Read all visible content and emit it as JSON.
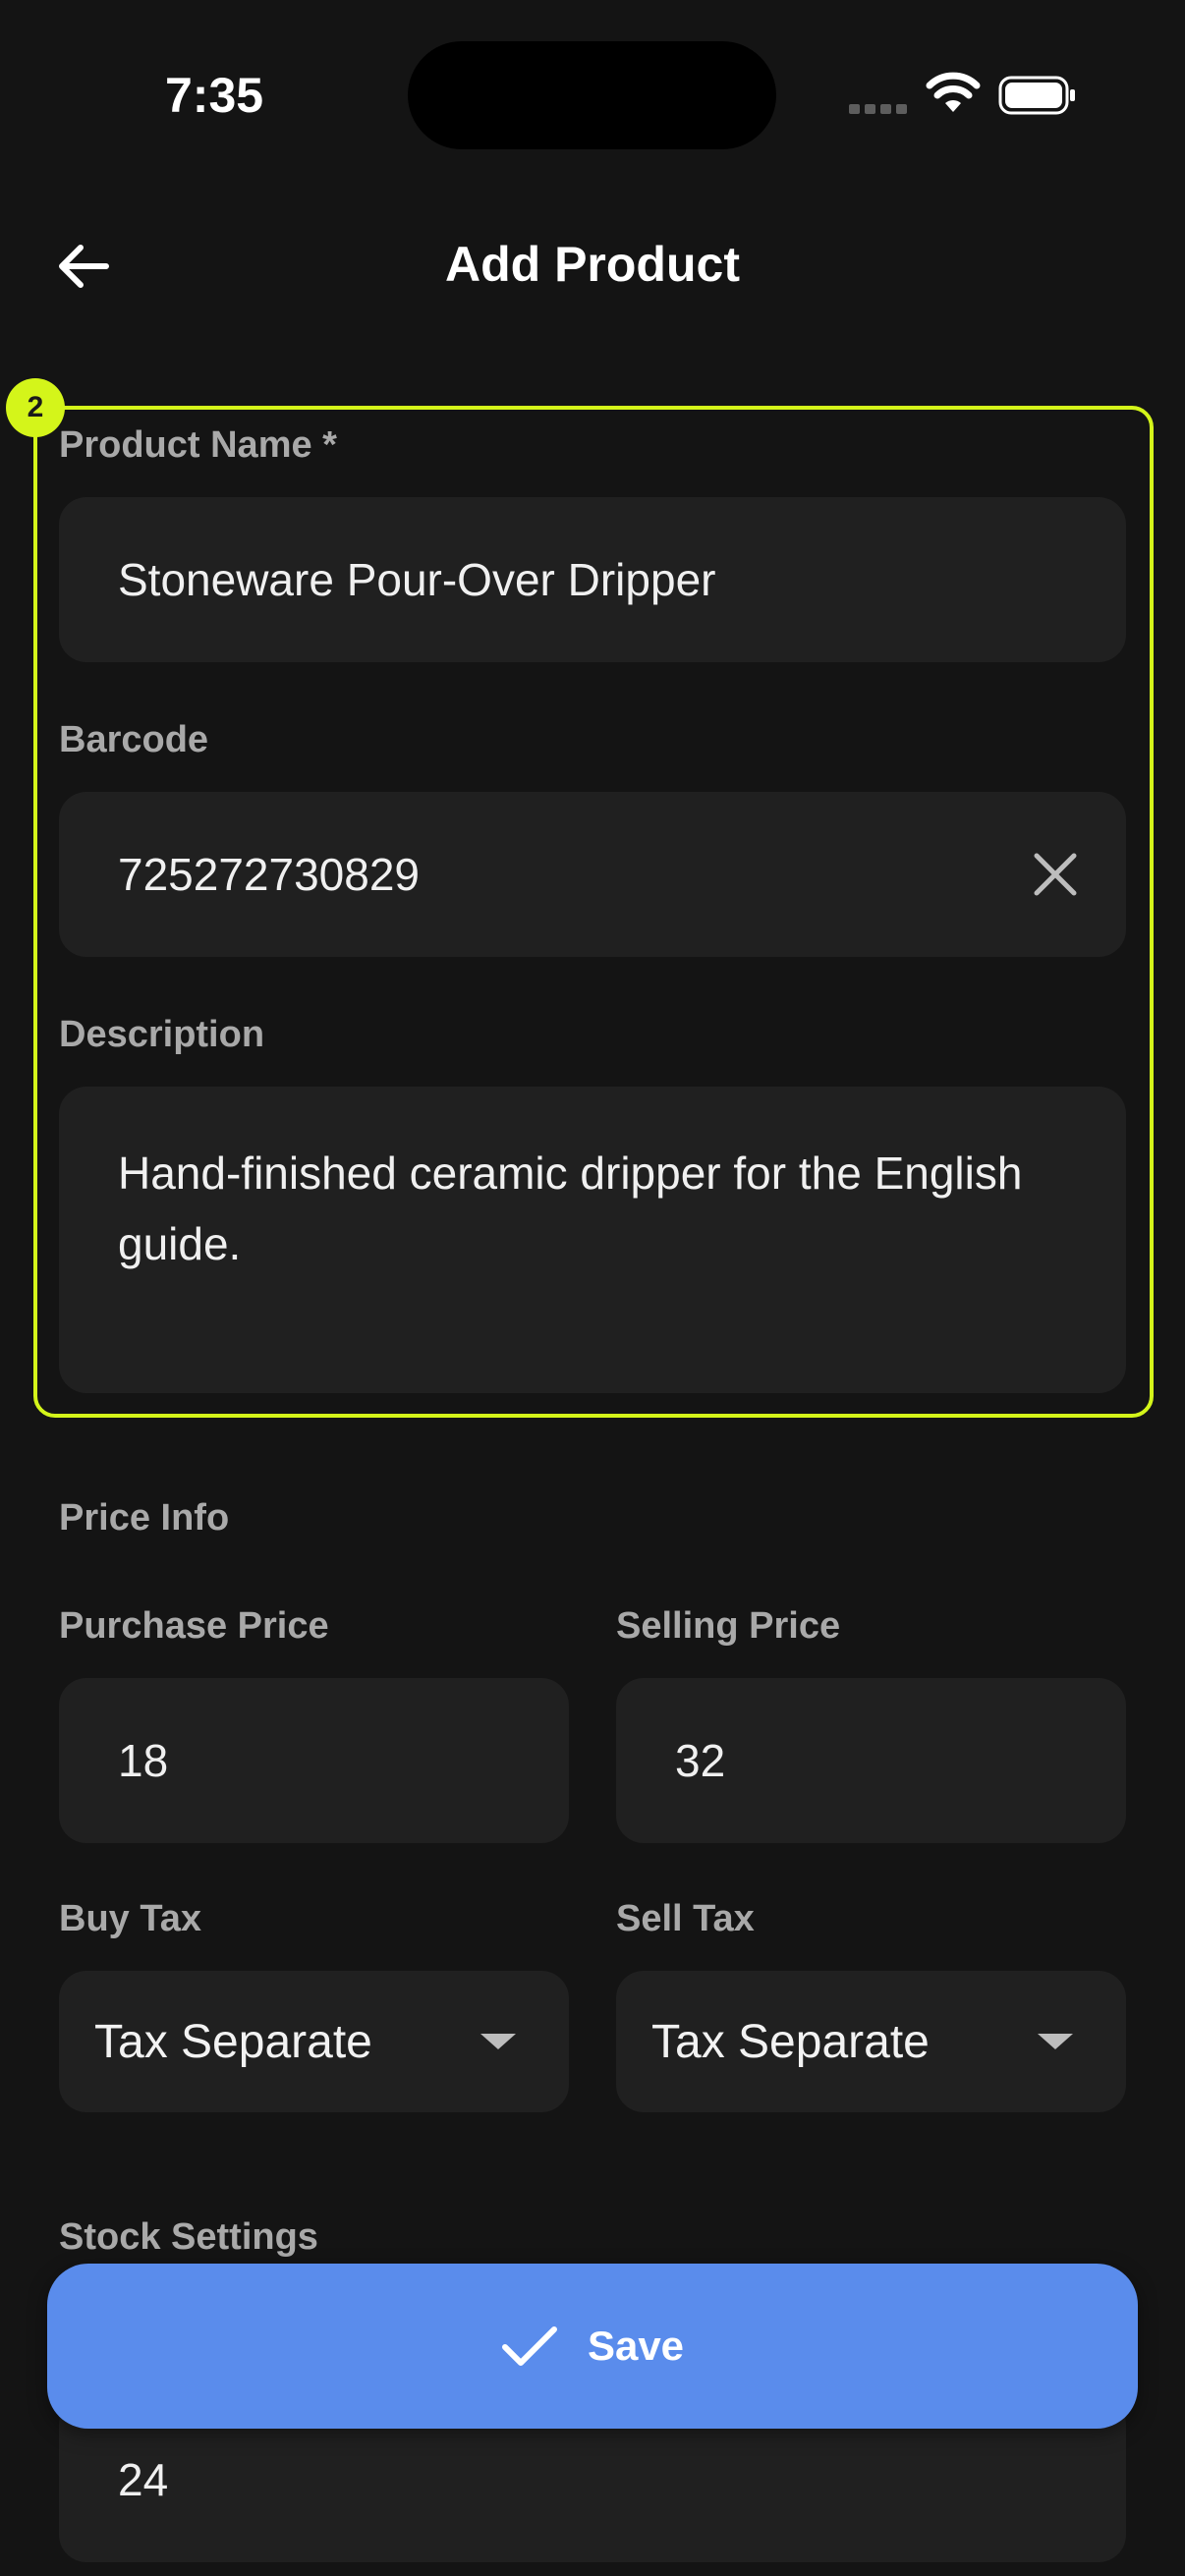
{
  "status_bar": {
    "time": "7:35"
  },
  "header": {
    "title": "Add Product"
  },
  "highlight": {
    "badge": "2"
  },
  "form": {
    "product_name": {
      "label": "Product Name *",
      "value": "Stoneware Pour-Over Dripper"
    },
    "barcode": {
      "label": "Barcode",
      "value": "725272730829"
    },
    "description": {
      "label": "Description",
      "value": "Hand-finished ceramic dripper for the English guide."
    }
  },
  "price_info": {
    "section_label": "Price Info",
    "purchase_price": {
      "label": "Purchase Price",
      "value": "18"
    },
    "selling_price": {
      "label": "Selling Price",
      "value": "32"
    },
    "buy_tax": {
      "label": "Buy Tax",
      "selected": "Tax Separate"
    },
    "sell_tax": {
      "label": "Sell Tax",
      "selected": "Tax Separate"
    }
  },
  "stock_settings": {
    "section_label": "Stock Settings",
    "value": "24"
  },
  "actions": {
    "save_label": "Save"
  },
  "colors": {
    "accent": "#5a8cec",
    "highlight": "#d4f51a",
    "background": "#141414",
    "field": "#202020"
  }
}
